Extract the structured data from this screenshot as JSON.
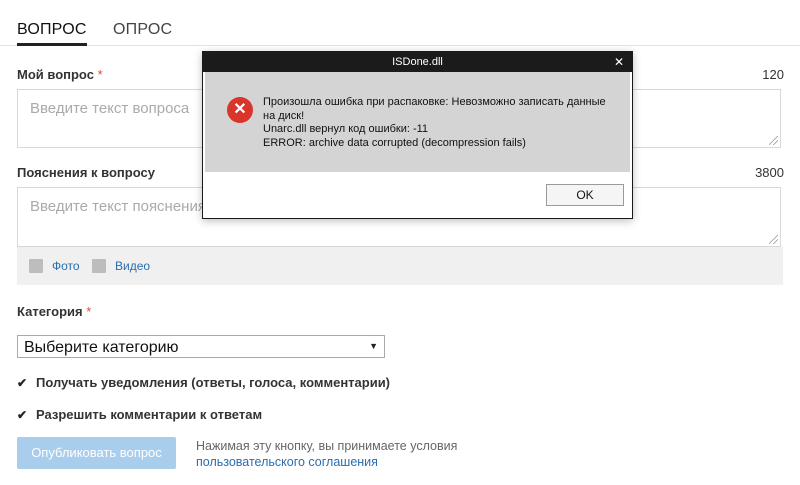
{
  "tabs": [
    {
      "label": "ВОПРОС"
    },
    {
      "label": "ОПРОС"
    }
  ],
  "question": {
    "label": "Мой вопрос",
    "required_mark": "*",
    "counter": "120",
    "placeholder": "Введите текст вопроса"
  },
  "details": {
    "label": "Пояснения к вопросу",
    "counter": "3800",
    "placeholder": "Введите текст пояснения"
  },
  "media": {
    "photo_label": "Фото",
    "video_label": "Видео"
  },
  "category": {
    "label": "Категория",
    "required_mark": "*",
    "selected": "Выберите категорию",
    "arrow": "▼"
  },
  "options": [
    {
      "label": "Получать уведомления (ответы, голоса, комментарии)",
      "checked": true
    },
    {
      "label": "Разрешить комментарии к ответам",
      "checked": true
    }
  ],
  "check_mark": "✔",
  "publish_label": "Опубликовать вопрос",
  "terms": {
    "text": "Нажимая эту кнопку, вы принимаете условия",
    "link": "пользовательского соглашения"
  },
  "dialog": {
    "title": "ISDone.dll",
    "close": "✕",
    "icon_glyph": "✕",
    "line1": "Произошла ошибка при распаковке: Невозможно записать данные",
    "line2": "на диск!",
    "line3": "Unarc.dll вернул код ошибки: -11",
    "line4": "ERROR: archive data corrupted (decompression fails)",
    "ok_label": "OK"
  },
  "colors": {
    "accent": "#2a6db0",
    "publish_button": "#a9cdec",
    "error_icon": "#d9352b",
    "required": "#e0463f"
  }
}
